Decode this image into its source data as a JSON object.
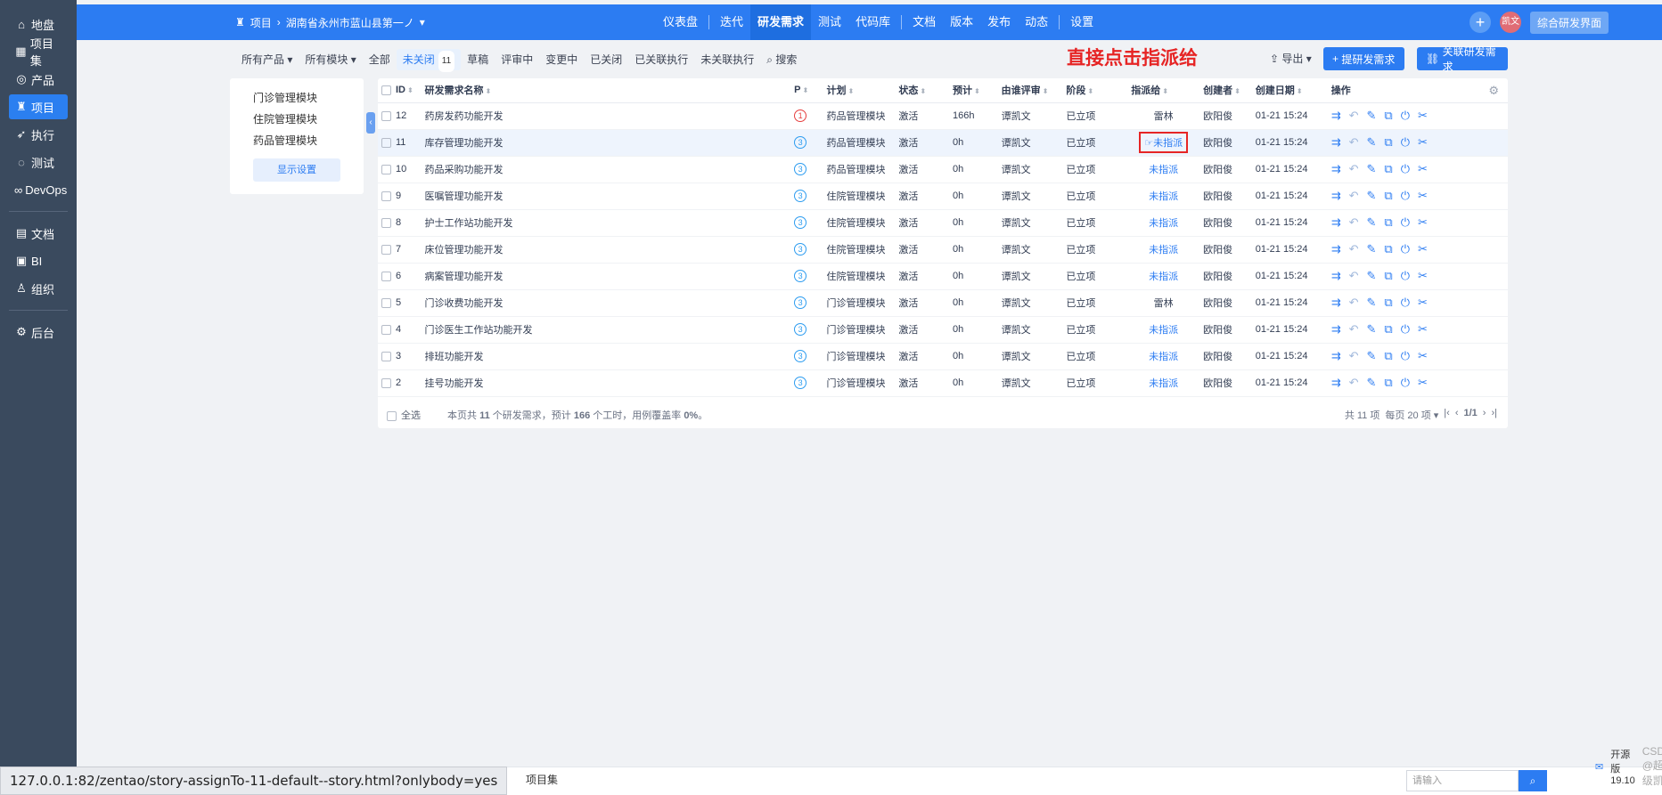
{
  "sidebar": {
    "items": [
      {
        "icon": "home-icon",
        "glyph": "⌂",
        "label": "地盘"
      },
      {
        "icon": "grid-icon",
        "glyph": "▦",
        "label": "项目集"
      },
      {
        "icon": "bulb-icon",
        "glyph": "◎",
        "label": "产品"
      },
      {
        "icon": "project-icon",
        "glyph": "♜",
        "label": "项目"
      },
      {
        "icon": "run-icon",
        "glyph": "➶",
        "label": "执行"
      },
      {
        "icon": "test-icon",
        "glyph": "◌",
        "label": "测试"
      },
      {
        "icon": "infinity-icon",
        "glyph": "∞",
        "label": "DevOps"
      },
      {
        "icon": "doc-icon",
        "glyph": "▤",
        "label": "文档"
      },
      {
        "icon": "bi-icon",
        "glyph": "▣",
        "label": "BI"
      },
      {
        "icon": "org-icon",
        "glyph": "♙",
        "label": "组织"
      },
      {
        "icon": "gear-icon",
        "glyph": "⚙",
        "label": "后台"
      }
    ]
  },
  "topbar": {
    "crumb_root": "项目",
    "crumb_project": "湖南省永州市蓝山县第一ノ",
    "nav": [
      "仪表盘",
      "迭代",
      "研发需求",
      "测试",
      "代码库",
      "文档",
      "版本",
      "发布",
      "动态",
      "设置"
    ],
    "avatar_text": "凯文",
    "mode_label": "综合研发界面"
  },
  "subnav": {
    "tabs": [
      "所有产品",
      "所有模块",
      "全部",
      "未关闭",
      "草稿",
      "评审中",
      "变更中",
      "已关闭",
      "已关联执行",
      "未关联执行",
      "搜索"
    ],
    "unclosed_count": "11",
    "export_label": "导出",
    "create_label": "提研发需求",
    "link_label": "关联研发需求"
  },
  "annotation": "直接点击指派给",
  "modules": {
    "items": [
      "门诊管理模块",
      "住院管理模块",
      "药品管理模块"
    ],
    "settings_label": "显示设置"
  },
  "table": {
    "headers": [
      "ID",
      "研发需求名称",
      "P",
      "计划",
      "状态",
      "预计",
      "由谁评审",
      "阶段",
      "指派给",
      "创建者",
      "创建日期",
      "操作"
    ],
    "rows": [
      {
        "id": "12",
        "name": "药房发药功能开发",
        "pri": "1",
        "plan": "药品管理模块",
        "status": "激活",
        "estimate": "166h",
        "reviewer": "谭凯文",
        "stage": "已立项",
        "assigned": "雷林",
        "creator": "欧阳俊",
        "date": "01-21 15:24"
      },
      {
        "id": "11",
        "name": "库存管理功能开发",
        "pri": "3",
        "plan": "药品管理模块",
        "status": "激活",
        "estimate": "0h",
        "reviewer": "谭凯文",
        "stage": "已立项",
        "assigned": "未指派",
        "creator": "欧阳俊",
        "date": "01-21 15:24"
      },
      {
        "id": "10",
        "name": "药品采购功能开发",
        "pri": "3",
        "plan": "药品管理模块",
        "status": "激活",
        "estimate": "0h",
        "reviewer": "谭凯文",
        "stage": "已立项",
        "assigned": "未指派",
        "creator": "欧阳俊",
        "date": "01-21 15:24"
      },
      {
        "id": "9",
        "name": "医嘱管理功能开发",
        "pri": "3",
        "plan": "住院管理模块",
        "status": "激活",
        "estimate": "0h",
        "reviewer": "谭凯文",
        "stage": "已立项",
        "assigned": "未指派",
        "creator": "欧阳俊",
        "date": "01-21 15:24"
      },
      {
        "id": "8",
        "name": "护士工作站功能开发",
        "pri": "3",
        "plan": "住院管理模块",
        "status": "激活",
        "estimate": "0h",
        "reviewer": "谭凯文",
        "stage": "已立项",
        "assigned": "未指派",
        "creator": "欧阳俊",
        "date": "01-21 15:24"
      },
      {
        "id": "7",
        "name": "床位管理功能开发",
        "pri": "3",
        "plan": "住院管理模块",
        "status": "激活",
        "estimate": "0h",
        "reviewer": "谭凯文",
        "stage": "已立项",
        "assigned": "未指派",
        "creator": "欧阳俊",
        "date": "01-21 15:24"
      },
      {
        "id": "6",
        "name": "病案管理功能开发",
        "pri": "3",
        "plan": "住院管理模块",
        "status": "激活",
        "estimate": "0h",
        "reviewer": "谭凯文",
        "stage": "已立项",
        "assigned": "未指派",
        "creator": "欧阳俊",
        "date": "01-21 15:24"
      },
      {
        "id": "5",
        "name": "门诊收费功能开发",
        "pri": "3",
        "plan": "门诊管理模块",
        "status": "激活",
        "estimate": "0h",
        "reviewer": "谭凯文",
        "stage": "已立项",
        "assigned": "雷林",
        "creator": "欧阳俊",
        "date": "01-21 15:24"
      },
      {
        "id": "4",
        "name": "门诊医生工作站功能开发",
        "pri": "3",
        "plan": "门诊管理模块",
        "status": "激活",
        "estimate": "0h",
        "reviewer": "谭凯文",
        "stage": "已立项",
        "assigned": "未指派",
        "creator": "欧阳俊",
        "date": "01-21 15:24"
      },
      {
        "id": "3",
        "name": "排班功能开发",
        "pri": "3",
        "plan": "门诊管理模块",
        "status": "激活",
        "estimate": "0h",
        "reviewer": "谭凯文",
        "stage": "已立项",
        "assigned": "未指派",
        "creator": "欧阳俊",
        "date": "01-21 15:24"
      },
      {
        "id": "2",
        "name": "挂号功能开发",
        "pri": "3",
        "plan": "门诊管理模块",
        "status": "激活",
        "estimate": "0h",
        "reviewer": "谭凯文",
        "stage": "已立项",
        "assigned": "未指派",
        "creator": "欧阳俊",
        "date": "01-21 15:24"
      }
    ],
    "select_all": "全选",
    "summary_prefix": "本页共",
    "summary_count": "11",
    "summary_mid": "个研发需求，预计",
    "summary_hours": "166",
    "summary_mid2": "个工时，用例覆盖率",
    "summary_coverage": "0%",
    "summary_end": "。",
    "pager_total": "共 11 项",
    "pager_per": "每页 20 项",
    "pager_page": "1/1"
  },
  "bottombar": {
    "status_url": "127.0.0.1:82/zentao/story-assignTo-11-default--story.html?onlybody=yes",
    "crumb": "项目集",
    "search_placeholder": "请输入",
    "version_label": "开源版19.10",
    "watermark": "CSDN @超级凯"
  },
  "colors": {
    "brand": "#2c7cf2",
    "sidebar": "#3a4a5e",
    "annotation": "#e62525"
  }
}
